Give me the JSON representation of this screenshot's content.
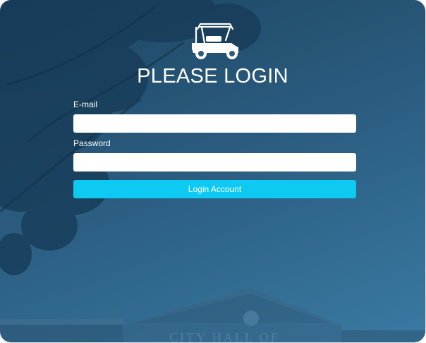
{
  "logo": {
    "icon": "golf-cart-icon",
    "color": "#ffffff"
  },
  "login": {
    "title": "PLEASE LOGIN",
    "email_label": "E-mail",
    "email_value": "",
    "password_label": "Password",
    "password_value": "",
    "submit_label": "Login Account"
  },
  "background": {
    "building_sign": "CITY HALL OF",
    "colors": {
      "primary": "#2a5b7e",
      "accent": "#0ecaf2"
    }
  }
}
